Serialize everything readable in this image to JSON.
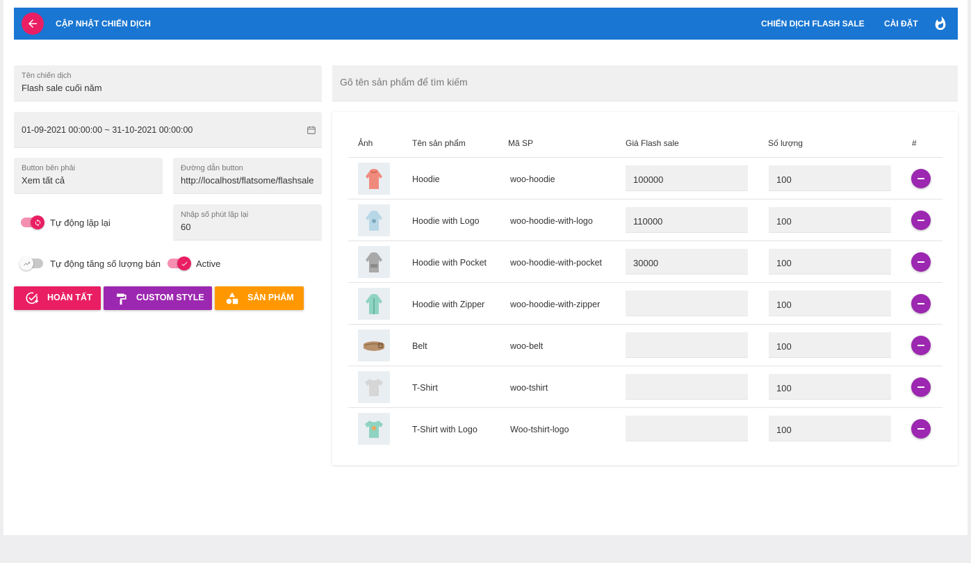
{
  "header": {
    "title": "CẬP NHẬT CHIẾN DỊCH",
    "links": [
      "CHIẾN DỊCH FLASH SALE",
      "CÀI ĐẶT"
    ],
    "bg_color": "#1976d2",
    "back_button_color": "#e91e63"
  },
  "form": {
    "campaign_name": {
      "label": "Tên chiến dịch",
      "value": "Flash sale cuối năm"
    },
    "date_range": {
      "value": "01-09-2021 00:00:00 ~ 31-10-2021 00:00:00",
      "icon": "calendar-icon"
    },
    "right_button": {
      "label": "Button bên phải",
      "value": "Xem tất cả"
    },
    "button_link": {
      "label": "Đường dẫn button",
      "value": "http://localhost/flatsome/flashsale"
    },
    "repeat_minutes": {
      "label": "Nhập số phút lặp lại",
      "value": "60"
    },
    "toggles": {
      "auto_repeat": {
        "label": "Tự động lặp lại",
        "on": true
      },
      "auto_increase": {
        "label": "Tự động tăng số lượng bán",
        "on": false
      },
      "active": {
        "label": "Active",
        "on": true
      }
    }
  },
  "actions": [
    {
      "label": "HOÀN TẤT",
      "color": "#e91e63",
      "icon": "check-add-icon"
    },
    {
      "label": "CUSTOM STYLE",
      "color": "#9c27b0",
      "icon": "paint-roller-icon"
    },
    {
      "label": "SẢN PHẨM",
      "color": "#ff9800",
      "icon": "shapes-icon"
    }
  ],
  "search": {
    "placeholder": "Gõ tên sản phẩm để tìm kiếm"
  },
  "table": {
    "columns": [
      "Ảnh",
      "Tên sản phẩm",
      "Mã SP",
      "Giá Flash sale",
      "Số lượng",
      "#"
    ],
    "rows": [
      {
        "name": "Hoodie",
        "sku": "woo-hoodie",
        "price": "100000",
        "qty": "100",
        "thumb": "hoodie-pink"
      },
      {
        "name": "Hoodie with Logo",
        "sku": "woo-hoodie-with-logo",
        "price": "110000",
        "qty": "100",
        "thumb": "hoodie-blue"
      },
      {
        "name": "Hoodie with Pocket",
        "sku": "woo-hoodie-with-pocket",
        "price": "30000",
        "qty": "100",
        "thumb": "hoodie-gray"
      },
      {
        "name": "Hoodie with Zipper",
        "sku": "woo-hoodie-with-zipper",
        "price": "",
        "qty": "100",
        "thumb": "hoodie-mint"
      },
      {
        "name": "Belt",
        "sku": "woo-belt",
        "price": "",
        "qty": "100",
        "thumb": "belt"
      },
      {
        "name": "T-Shirt",
        "sku": "woo-tshirt",
        "price": "",
        "qty": "100",
        "thumb": "tshirt-gray"
      },
      {
        "name": "T-Shirt with Logo",
        "sku": "Woo-tshirt-logo",
        "price": "",
        "qty": "100",
        "thumb": "tshirt-mint"
      }
    ]
  }
}
